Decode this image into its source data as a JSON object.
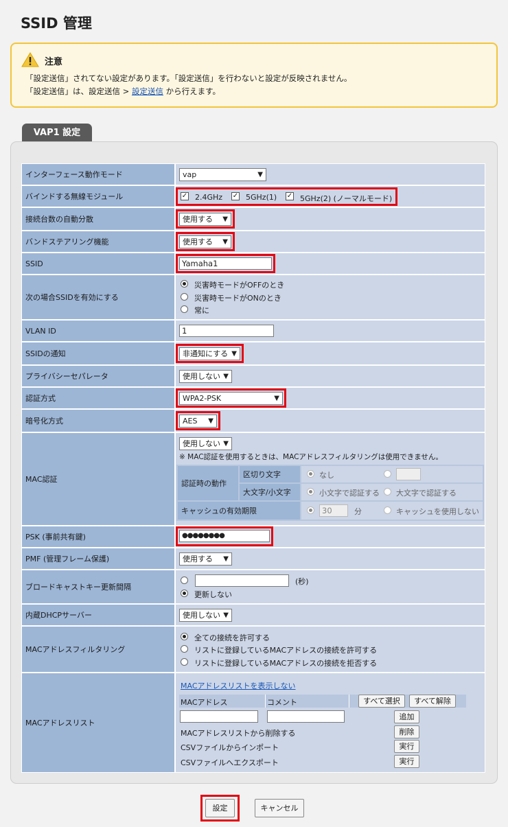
{
  "page": {
    "title": "SSID 管理"
  },
  "warning": {
    "title": "注意",
    "line1": "「設定送信」されてない設定があります。「設定送信」を行わないと設定が反映されません。",
    "line2_pre": "「設定送信」は、設定送信 > ",
    "line2_link": "設定送信",
    "line2_post": " から行えます。"
  },
  "tab": {
    "label": "VAP1 設定"
  },
  "form": {
    "interface_mode": {
      "label": "インターフェース動作モード",
      "value": "vap"
    },
    "bind_module": {
      "label": "バインドする無線モジュール",
      "opt1": "2.4GHz",
      "opt2": "5GHz(1)",
      "opt3": "5GHz(2) (ノーマルモード)"
    },
    "auto_distribution": {
      "label": "接続台数の自動分散",
      "value": "使用する"
    },
    "band_steering": {
      "label": "バンドステアリング機能",
      "value": "使用する"
    },
    "ssid": {
      "label": "SSID",
      "value": "Yamaha1"
    },
    "enable_ssid": {
      "label": "次の場合SSIDを有効にする",
      "opt1": "災害時モードがOFFのとき",
      "opt2": "災害時モードがONのとき",
      "opt3": "常に"
    },
    "vlan_id": {
      "label": "VLAN ID",
      "value": "1"
    },
    "ssid_notify": {
      "label": "SSIDの通知",
      "value": "非通知にする"
    },
    "privacy_separator": {
      "label": "プライバシーセパレータ",
      "value": "使用しない"
    },
    "auth_method": {
      "label": "認証方式",
      "value": "WPA2-PSK"
    },
    "encryption": {
      "label": "暗号化方式",
      "value": "AES"
    },
    "mac_auth": {
      "label": "MAC認証",
      "value": "使用しない",
      "note": "※ MAC認証を使用するときは、MACアドレスフィルタリングは使用できません。",
      "behavior_label": "認証時の動作",
      "delimiter_label": "区切り文字",
      "delimiter_none": "なし",
      "case_label": "大文字/小文字",
      "case_lower": "小文字で認証する",
      "case_upper": "大文字で認証する",
      "cache_label": "キャッシュの有効期限",
      "cache_value": "30",
      "cache_unit": "分",
      "cache_none": "キャッシュを使用しない"
    },
    "psk": {
      "label": "PSK (事前共有鍵)",
      "value": "●●●●●●●●"
    },
    "pmf": {
      "label": "PMF (管理フレーム保護)",
      "value": "使用する"
    },
    "broadcast_key": {
      "label": "ブロードキャストキー更新間隔",
      "unit": "(秒)",
      "opt_no_update": "更新しない"
    },
    "dhcp": {
      "label": "内蔵DHCPサーバー",
      "value": "使用しない"
    },
    "mac_filter": {
      "label": "MACアドレスフィルタリング",
      "opt1": "全ての接続を許可する",
      "opt2": "リストに登録しているMACアドレスの接続を許可する",
      "opt3": "リストに登録しているMACアドレスの接続を拒否する"
    },
    "mac_list": {
      "label": "MACアドレスリスト",
      "hide_link": "MACアドレスリストを表示しない",
      "col_mac": "MACアドレス",
      "col_comment": "コメント",
      "select_all": "すべて選択",
      "deselect_all": "すべて解除",
      "add": "追加",
      "delete_label": "MACアドレスリストから削除する",
      "delete_btn": "削除",
      "import_label": "CSVファイルからインポート",
      "import_btn": "実行",
      "export_label": "CSVファイルへエクスポート",
      "export_btn": "実行"
    }
  },
  "footer": {
    "submit": "設定",
    "cancel": "キャンセル"
  },
  "colors": {
    "label_bg": "#9db6d6",
    "value_bg": "#ccd6e7",
    "highlight": "#e30613",
    "warning_border": "#f3c53a"
  }
}
